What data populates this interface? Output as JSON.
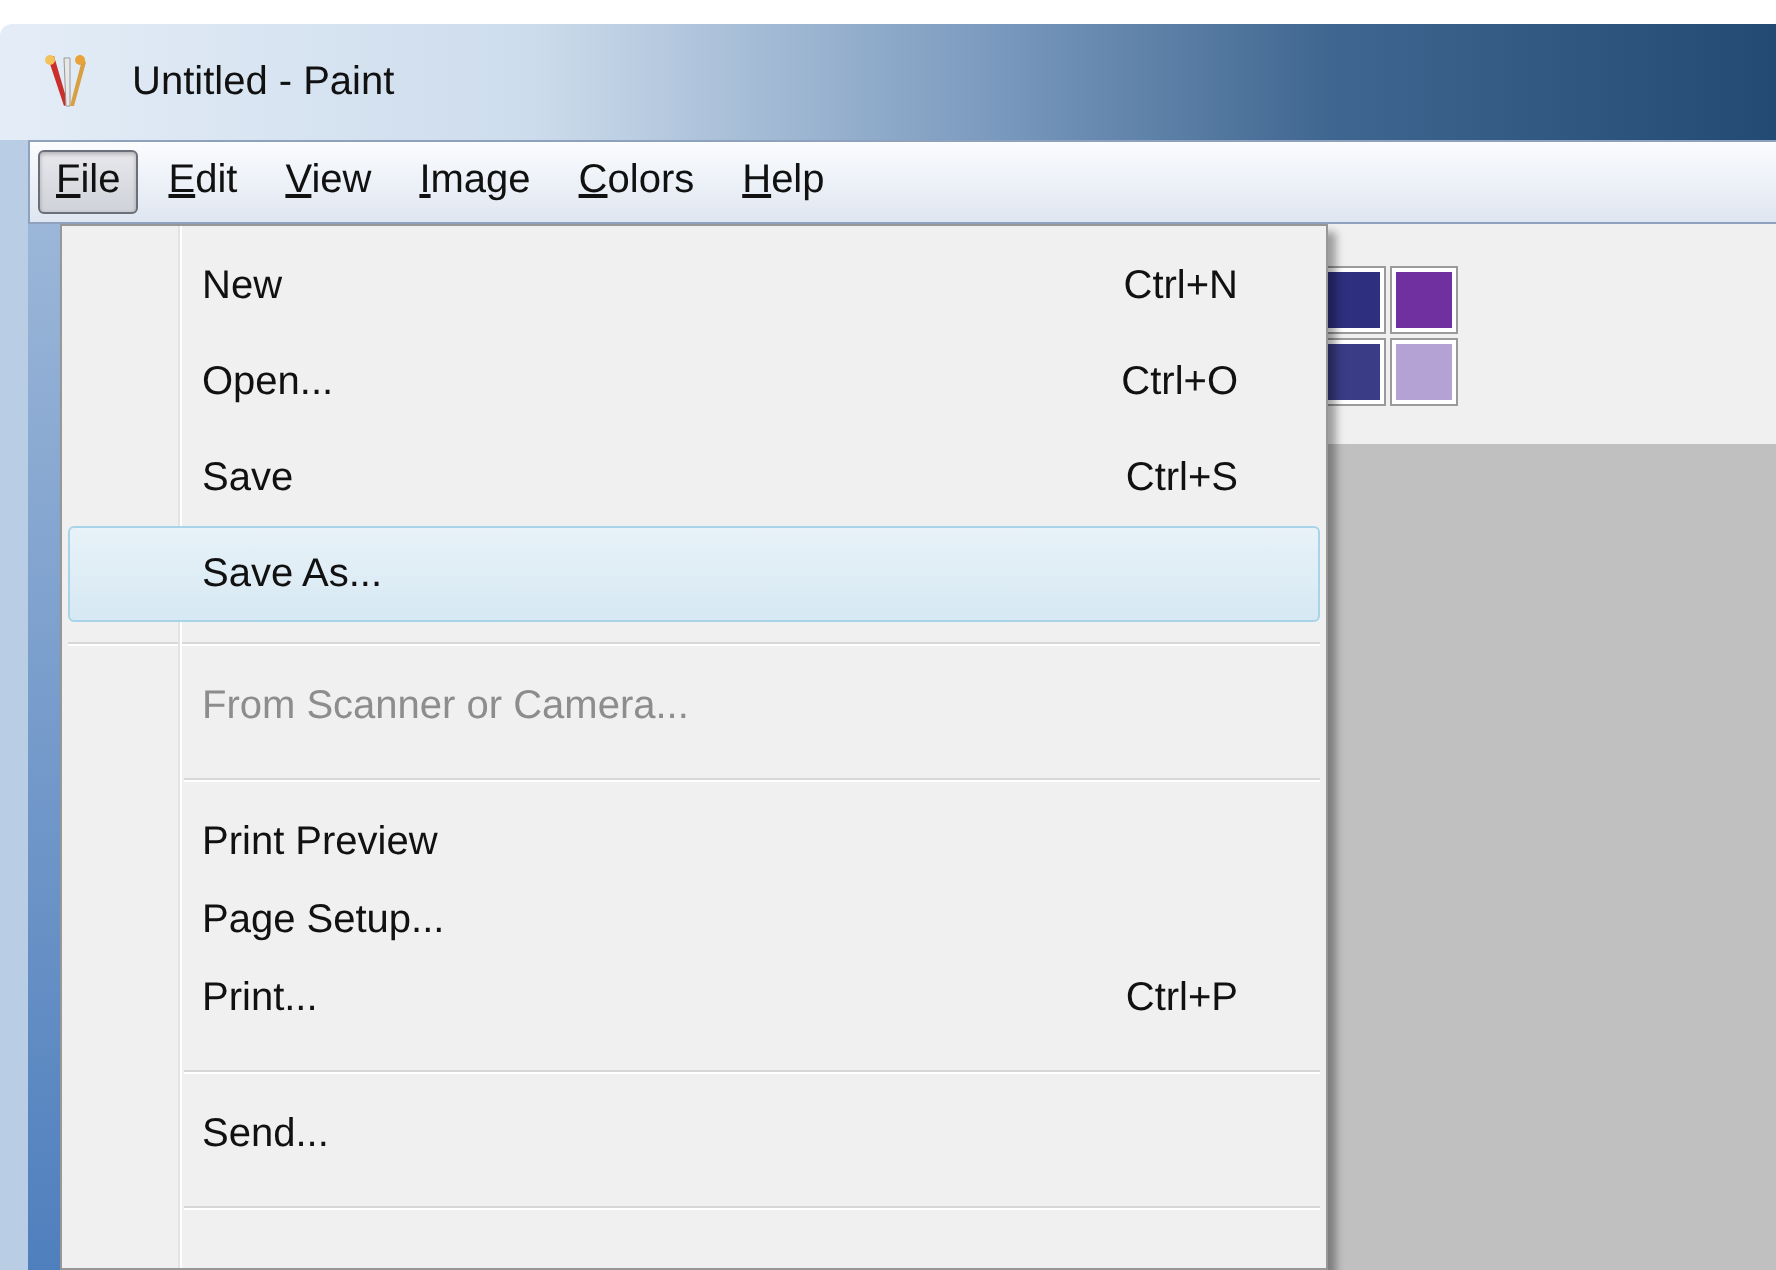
{
  "window": {
    "title": "Untitled - Paint"
  },
  "menu_bar": [
    {
      "label": "File",
      "underline_first": true,
      "selected": true
    },
    {
      "label": "Edit",
      "underline_first": true,
      "selected": false
    },
    {
      "label": "View",
      "underline_first": true,
      "selected": false
    },
    {
      "label": "Image",
      "underline_first": true,
      "selected": false
    },
    {
      "label": "Colors",
      "underline_first": true,
      "selected": false
    },
    {
      "label": "Help",
      "underline_first": true,
      "selected": false
    }
  ],
  "file_menu": {
    "groups": [
      [
        {
          "label": "New",
          "shortcut": "Ctrl+N",
          "selected": false,
          "disabled": false
        },
        {
          "label": "Open...",
          "shortcut": "Ctrl+O",
          "selected": false,
          "disabled": false
        },
        {
          "label": "Save",
          "shortcut": "Ctrl+S",
          "selected": false,
          "disabled": false
        },
        {
          "label": "Save As...",
          "selected": true,
          "disabled": false
        }
      ],
      [
        {
          "label": "From Scanner or Camera...",
          "selected": false,
          "disabled": true
        }
      ],
      [
        {
          "label": "Print Preview",
          "selected": false,
          "disabled": false
        },
        {
          "label": "Page Setup...",
          "selected": false,
          "disabled": false
        },
        {
          "label": "Print...",
          "shortcut": "Ctrl+P",
          "selected": false,
          "disabled": false
        }
      ],
      [
        {
          "label": "Send...",
          "selected": false,
          "disabled": false
        }
      ]
    ]
  },
  "palette": [
    [
      {
        "color": "#2e2f7e"
      },
      {
        "color": "#7030a0"
      }
    ],
    [
      {
        "color": "#3a3c86"
      },
      {
        "color": "#b4a2d4"
      }
    ]
  ]
}
